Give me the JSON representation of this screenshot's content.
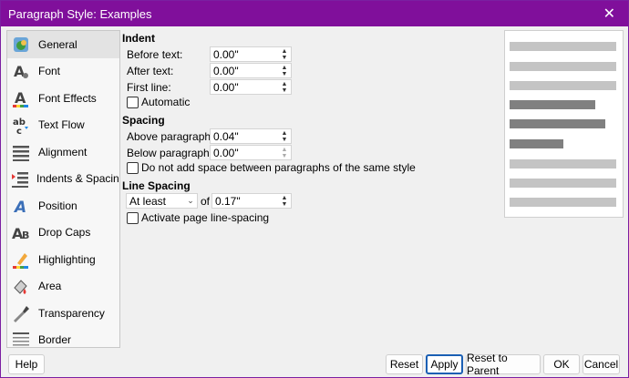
{
  "window": {
    "title": "Paragraph Style: Examples",
    "close_glyph": "✕"
  },
  "sidebar": {
    "items": [
      {
        "label": "General",
        "icon": "general-icon",
        "selected": true
      },
      {
        "label": "Font",
        "icon": "font-icon"
      },
      {
        "label": "Font Effects",
        "icon": "font-effects-icon"
      },
      {
        "label": "Text Flow",
        "icon": "text-flow-icon"
      },
      {
        "label": "Alignment",
        "icon": "alignment-icon"
      },
      {
        "label": "Indents & Spacing",
        "icon": "indents-spacing-icon"
      },
      {
        "label": "Position",
        "icon": "position-icon"
      },
      {
        "label": "Drop Caps",
        "icon": "drop-caps-icon"
      },
      {
        "label": "Highlighting",
        "icon": "highlighting-icon"
      },
      {
        "label": "Area",
        "icon": "area-icon"
      },
      {
        "label": "Transparency",
        "icon": "transparency-icon"
      },
      {
        "label": "Border",
        "icon": "border-icon"
      }
    ]
  },
  "indent": {
    "title": "Indent",
    "before_label": "Before text:",
    "before_value": "0.00\"",
    "after_label": "After text:",
    "after_value": "0.00\"",
    "first_label": "First line:",
    "first_value": "0.00\"",
    "automatic_label": "Automatic"
  },
  "spacing": {
    "title": "Spacing",
    "above_label": "Above paragraph:",
    "above_value": "0.04\"",
    "below_label": "Below paragraph:",
    "below_value": "0.00\"",
    "no_space_label": "Do not add space between paragraphs of the same style"
  },
  "line_spacing": {
    "title": "Line Spacing",
    "mode_value": "At least",
    "of_label": "of",
    "of_value": "0.17\"",
    "page_line_label": "Activate page line-spacing"
  },
  "buttons": {
    "help": "Help",
    "reset": "Reset",
    "apply": "Apply",
    "reset_parent": "Reset to Parent",
    "ok": "OK",
    "cancel": "Cancel"
  },
  "arrows": {
    "up": "▲",
    "down": "▼",
    "chevron": "⌄"
  },
  "colors": {
    "titlebar": "#800f9b",
    "accent": "#1a5fb4",
    "preview_light": "#c4c4c4",
    "preview_dark": "#808080"
  }
}
